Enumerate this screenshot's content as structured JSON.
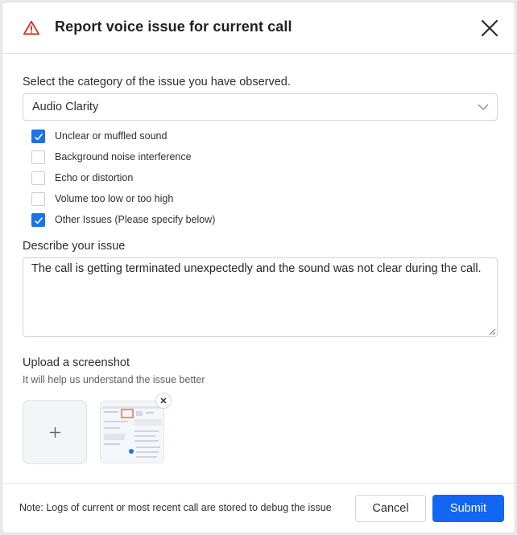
{
  "dialog": {
    "title": "Report voice issue for current call",
    "warning_icon": "warning-triangle-icon",
    "close_icon": "close-icon"
  },
  "category": {
    "label": "Select the category of the issue you have observed.",
    "selected": "Audio Clarity"
  },
  "options": [
    {
      "label": "Unclear or muffled sound",
      "checked": true
    },
    {
      "label": "Background noise interference",
      "checked": false
    },
    {
      "label": "Echo or distortion",
      "checked": false
    },
    {
      "label": "Volume too low or too high",
      "checked": false
    },
    {
      "label": "Other Issues (Please specify below)",
      "checked": true
    }
  ],
  "describe": {
    "label": "Describe your issue",
    "value": "The call is getting terminated unexpectedly and the sound was not clear during the call."
  },
  "upload": {
    "label": "Upload a screenshot",
    "helper": "It will help us understand the issue better",
    "add_icon": "plus-icon",
    "remove_icon": "close-icon"
  },
  "footer": {
    "note": "Note: Logs of current or most recent call are stored to debug the issue",
    "cancel": "Cancel",
    "submit": "Submit"
  },
  "colors": {
    "accent": "#1266f1",
    "checkbox_checked": "#1a73e8",
    "warning": "#d93025"
  }
}
